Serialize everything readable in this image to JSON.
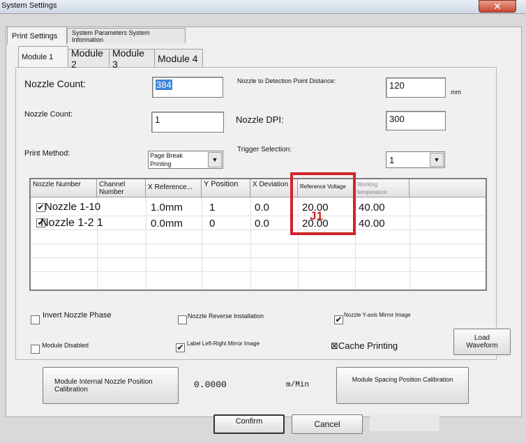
{
  "window": {
    "title": "System Settings",
    "close_icon": "✕"
  },
  "tabs": [
    "Print Settings",
    "System Parameters System Information"
  ],
  "modules": [
    "Module 1",
    "Module 2",
    "Module 3",
    "Module 4"
  ],
  "fields": {
    "nozzle_count_1": {
      "label": "Nozzle Count:",
      "value": "384"
    },
    "nozzle_count_2": {
      "label": "Nozzle Count:",
      "value": "1"
    },
    "detection_distance": {
      "label": "Nozzle to Detection Point Distance:",
      "value": "120",
      "unit": "mm"
    },
    "nozzle_dpi": {
      "label": "Nozzle DPI:",
      "value": "300"
    },
    "print_method": {
      "label": "Print Method:",
      "value": "Page Break Printing"
    },
    "trigger_selection": {
      "label": "Trigger Selection:",
      "value": "1"
    }
  },
  "grid": {
    "headers": [
      "Nozzle Number",
      "Channel Number",
      "X Reference...",
      "Y Position",
      "X Deviation",
      "Reference Voltage",
      "Working temperature"
    ],
    "rows": [
      {
        "checked": true,
        "name": "Nozzle 1-10",
        "x_ref": "1.0mm",
        "y_pos": "1",
        "x_dev": "0.0",
        "ref_voltage": "20.00",
        "temp": "40.00"
      },
      {
        "checked": true,
        "name": "Nozzle 1-2 1",
        "x_ref": "0.0mm",
        "y_pos": "0",
        "x_dev": "0.0",
        "ref_voltage": "20.00",
        "temp": "40.00"
      }
    ],
    "annotation": "J1"
  },
  "options": {
    "invert_phase": {
      "label": "Invert Nozzle Phase",
      "checked": false
    },
    "reverse_install": {
      "label": "Nozzle Reverse Installation",
      "checked": false
    },
    "y_mirror": {
      "label": "Nozzle Y-axis Mirror Image",
      "checked": true
    },
    "module_disabled": {
      "label": "Module Disabled",
      "checked": false
    },
    "lr_mirror": {
      "label": "Label Left-Right Mirror Image",
      "checked": true
    },
    "cache_printing": {
      "label": "⊠Cache Printing"
    }
  },
  "buttons": {
    "load_waveform": "Load Waveform",
    "internal_calibration": "Module Internal Nozzle Position Calibration",
    "spacing_calibration": "Module Spacing Position Calibration",
    "confirm": "Confirm",
    "cancel": "Cancel"
  },
  "speed": {
    "value": "0.0000",
    "unit": "m/Min"
  },
  "colors": {
    "annotation": "#d2232a",
    "selection": "#3b84d9"
  }
}
